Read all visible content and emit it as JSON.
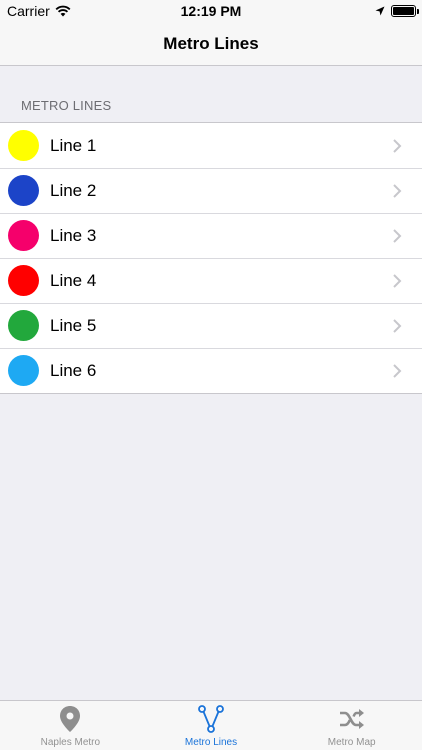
{
  "status_bar": {
    "carrier": "Carrier",
    "time": "12:19 PM"
  },
  "nav": {
    "title": "Metro Lines"
  },
  "section": {
    "header": "METRO LINES"
  },
  "lines": [
    {
      "label": "Line 1",
      "color": "#ffff00"
    },
    {
      "label": "Line 2",
      "color": "#1c44c8"
    },
    {
      "label": "Line 3",
      "color": "#f5006b"
    },
    {
      "label": "Line 4",
      "color": "#ff0000"
    },
    {
      "label": "Line 5",
      "color": "#22a83c"
    },
    {
      "label": "Line 6",
      "color": "#1ea9f3"
    }
  ],
  "tabs": [
    {
      "label": "Naples Metro",
      "icon": "map-pin-icon",
      "active": false
    },
    {
      "label": "Metro Lines",
      "icon": "network-branch-icon",
      "active": true
    },
    {
      "label": "Metro Map",
      "icon": "shuffle-icon",
      "active": false
    }
  ],
  "colors": {
    "accent": "#1a73d9",
    "inactive_tab": "#929292"
  }
}
